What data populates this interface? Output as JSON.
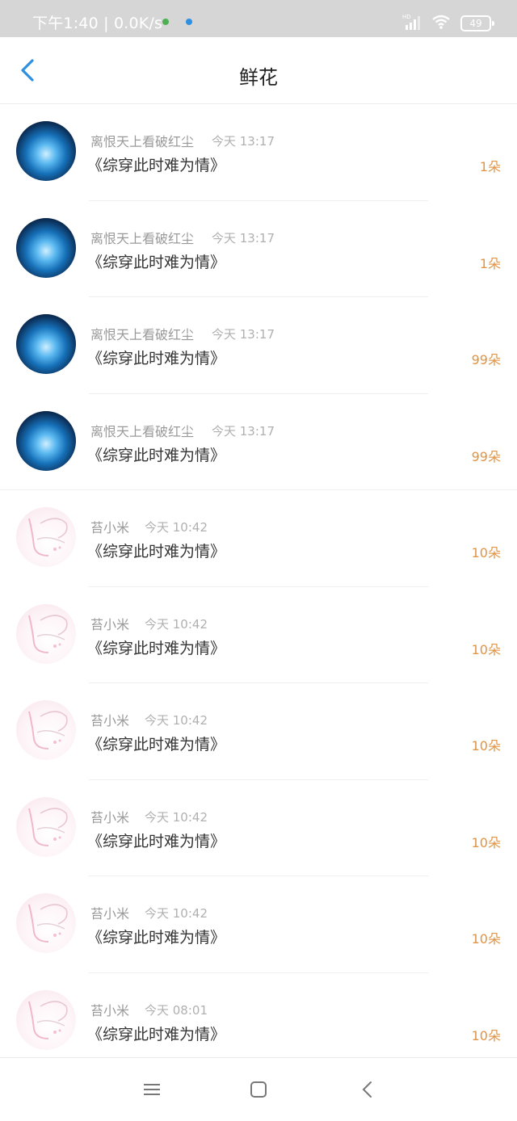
{
  "status_bar": {
    "left_text": "下午1:40 | 0.0K/s",
    "battery": "49",
    "icons": [
      "signal-hd-icon",
      "wifi-icon",
      "battery-icon"
    ]
  },
  "header": {
    "title": "鲜花",
    "back_icon": "back-chevron-icon"
  },
  "items": [
    {
      "name": "离恨天上看破红尘",
      "time": "今天 13:17",
      "book": "《综穿此时难为情》",
      "flowers": "1朵",
      "avatar": "blue"
    },
    {
      "name": "离恨天上看破红尘",
      "time": "今天 13:17",
      "book": "《综穿此时难为情》",
      "flowers": "1朵",
      "avatar": "blue"
    },
    {
      "name": "离恨天上看破红尘",
      "time": "今天 13:17",
      "book": "《综穿此时难为情》",
      "flowers": "99朵",
      "avatar": "blue"
    },
    {
      "name": "离恨天上看破红尘",
      "time": "今天 13:17",
      "book": "《综穿此时难为情》",
      "flowers": "99朵",
      "avatar": "blue"
    },
    {
      "name": "苔小米",
      "time": "今天 10:42",
      "book": "《综穿此时难为情》",
      "flowers": "10朵",
      "avatar": "pink"
    },
    {
      "name": "苔小米",
      "time": "今天 10:42",
      "book": "《综穿此时难为情》",
      "flowers": "10朵",
      "avatar": "pink"
    },
    {
      "name": "苔小米",
      "time": "今天 10:42",
      "book": "《综穿此时难为情》",
      "flowers": "10朵",
      "avatar": "pink"
    },
    {
      "name": "苔小米",
      "time": "今天 10:42",
      "book": "《综穿此时难为情》",
      "flowers": "10朵",
      "avatar": "pink"
    },
    {
      "name": "苔小米",
      "time": "今天 10:42",
      "book": "《综穿此时难为情》",
      "flowers": "10朵",
      "avatar": "pink"
    },
    {
      "name": "苔小米",
      "time": "今天 08:01",
      "book": "《综穿此时难为情》",
      "flowers": "10朵",
      "avatar": "pink"
    }
  ],
  "nav_bar": {
    "icons": [
      "menu-icon",
      "home-icon",
      "back-icon"
    ]
  },
  "colors": {
    "accent": "#2f8fe0",
    "flower_count": "#e09445",
    "status_bar_bg": "#d6d6d6"
  }
}
